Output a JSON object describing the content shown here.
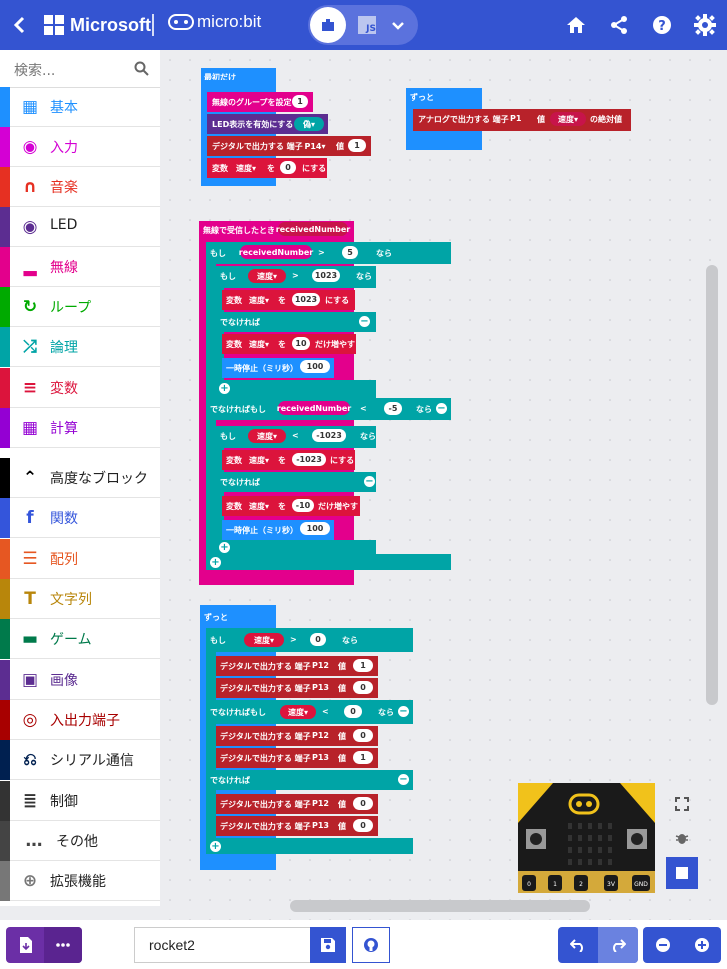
{
  "topbar": {
    "brand": "Microsoft",
    "product": "micro:bit",
    "js_label": "JS"
  },
  "sidebar": {
    "search_placeholder": "検索...",
    "categories": [
      {
        "label": "基本",
        "color": "#1e90ff"
      },
      {
        "label": "入力",
        "color": "#d400d4"
      },
      {
        "label": "音楽",
        "color": "#e63022"
      },
      {
        "label": "LED",
        "color": "#5c2d91"
      },
      {
        "label": "無線",
        "color": "#e3008c"
      },
      {
        "label": "ループ",
        "color": "#00aa00"
      },
      {
        "label": "論理",
        "color": "#00a4a6"
      },
      {
        "label": "変数",
        "color": "#dc143c"
      },
      {
        "label": "計算",
        "color": "#9400d3"
      },
      {
        "label": "高度なブロック",
        "color": "#000000"
      },
      {
        "label": "関数",
        "color": "#3455db"
      },
      {
        "label": "配列",
        "color": "#e65722"
      },
      {
        "label": "文字列",
        "color": "#b8860b"
      },
      {
        "label": "ゲーム",
        "color": "#007a4b"
      },
      {
        "label": "画像",
        "color": "#5c2d91"
      },
      {
        "label": "入出力端子",
        "color": "#a80000"
      },
      {
        "label": "シリアル通信",
        "color": "#002050"
      },
      {
        "label": "制御",
        "color": "#333333"
      },
      {
        "label": "その他",
        "color": "#444444"
      },
      {
        "label": "拡張機能",
        "color": "#777777"
      }
    ]
  },
  "blocks": {
    "on_start": {
      "hat": "最初だけ",
      "set_group": "無線のグループを設定",
      "set_group_val": "1",
      "led_enable": "LED表示を有効にする",
      "led_enable_val": "偽",
      "digital_write": "デジタルで出力する 端子",
      "digital_pin": "P14",
      "value_word": "値",
      "digital_val": "1",
      "var_word": "変数",
      "var_name": "速度",
      "to_word": "を",
      "var_val": "0",
      "set_word": "にする"
    },
    "forever1": {
      "hat": "ずっと",
      "analog": "アナログで出力する 端子",
      "pin": "P1",
      "value_word": "値",
      "var_name": "速度",
      "abs": "の絶対値"
    },
    "radio": {
      "hat": "無線で受信したとき",
      "param": "receivedNumber",
      "if_word": "もし",
      "op_gt": ">",
      "op_lt": "<",
      "val5": "5",
      "then_word": "なら",
      "speed": "速度",
      "v1023": "1023",
      "else_word": "でなければ",
      "elseif_word": "でなければもし",
      "v10": "10",
      "increase": "だけ増やす",
      "pause": "一時停止（ミリ秒）",
      "v100": "100",
      "vneg5": "-5",
      "vneg1023": "-1023",
      "vneg10": "-10"
    },
    "forever2": {
      "hat": "ずっと",
      "pin12": "P12",
      "pin13": "P13",
      "v0": "0",
      "v1": "1"
    }
  },
  "simulator": {
    "pins": [
      "0",
      "1",
      "2",
      "3V",
      "GND"
    ]
  },
  "bottombar": {
    "project_name": "rocket2"
  },
  "colors": {
    "topbar": "#3454d1",
    "radio": "#e3008c",
    "logic": "#00a4a6",
    "variables": "#dc143c",
    "pins": "#b8222a",
    "loops": "#1e90ff",
    "led": "#5c2d91"
  }
}
